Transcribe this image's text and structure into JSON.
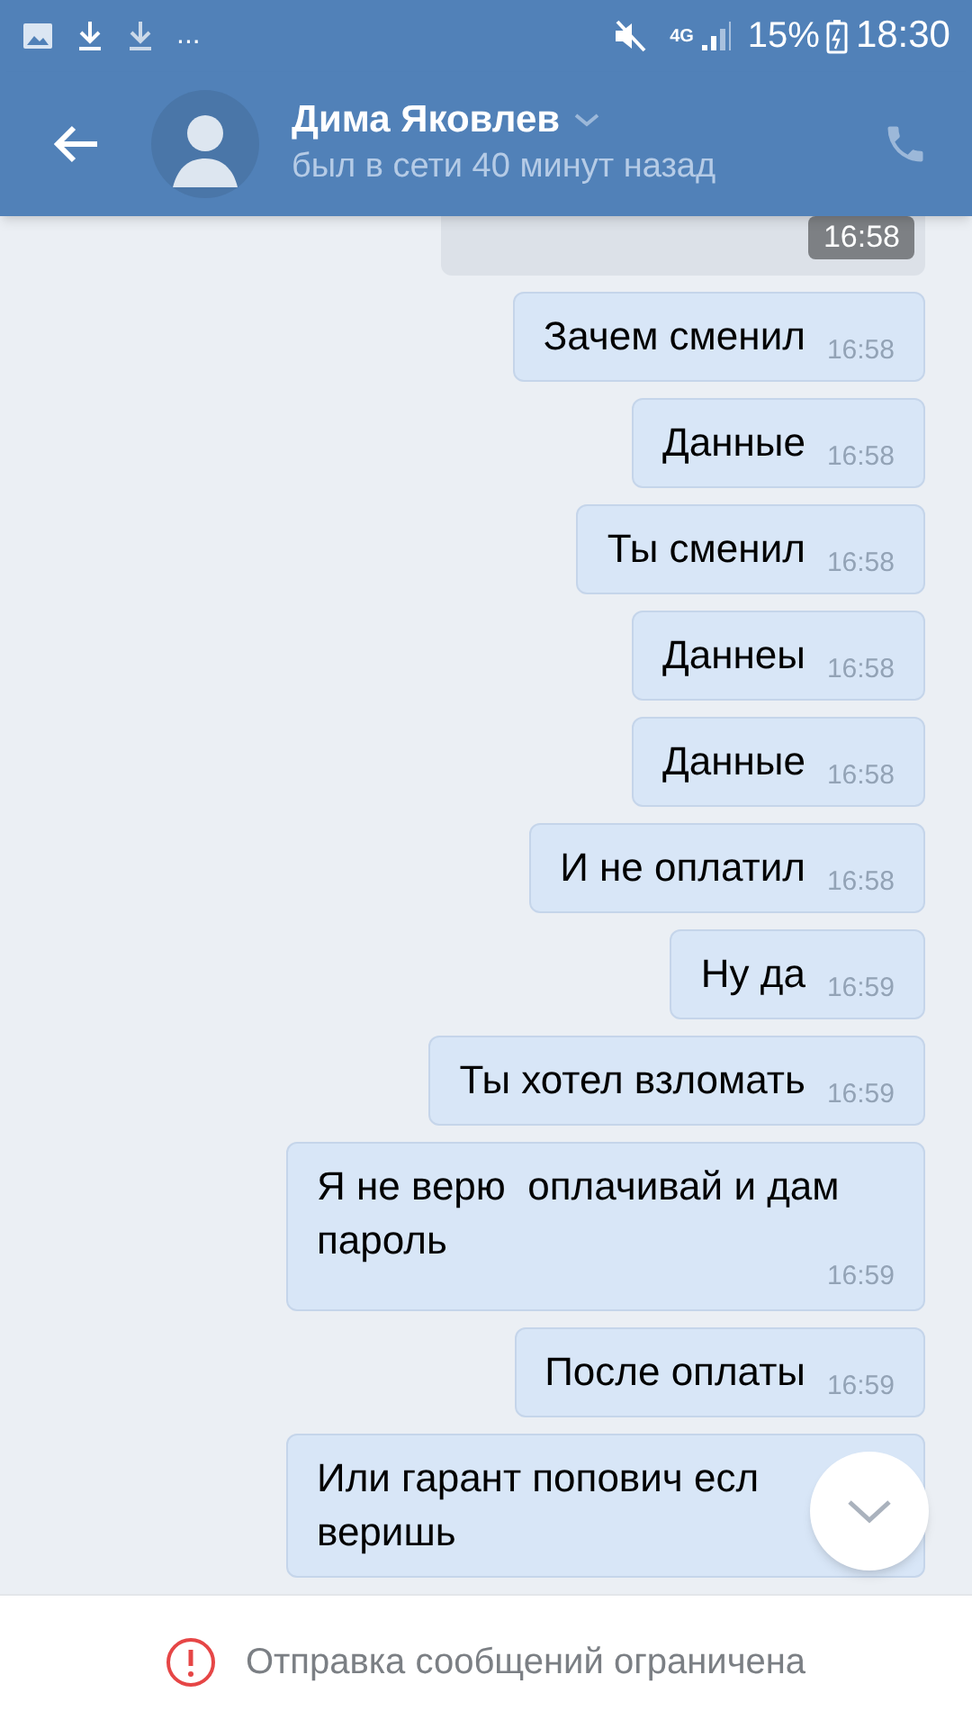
{
  "status_bar": {
    "more": "...",
    "network": "4G",
    "battery": "15%",
    "time": "18:30"
  },
  "header": {
    "name": "Дима Яковлев",
    "status": "был в сети 40 минут назад"
  },
  "top_message": {
    "time": "16:58"
  },
  "messages": [
    {
      "text": "Зачем сменил",
      "time": "16:58"
    },
    {
      "text": "Данные",
      "time": "16:58"
    },
    {
      "text": "Ты сменил",
      "time": "16:58"
    },
    {
      "text": "Даннеы",
      "time": "16:58"
    },
    {
      "text": "Данные",
      "time": "16:58"
    },
    {
      "text": "И не оплатил",
      "time": "16:58"
    },
    {
      "text": "Ну да",
      "time": "16:59"
    },
    {
      "text": "Ты хотел взломать",
      "time": "16:59"
    },
    {
      "text": "Я не верю  оплачивай и дам\nпароль",
      "time": "16:59"
    },
    {
      "text": "После оплаты",
      "time": "16:59"
    },
    {
      "text": "Или гарант попович есл\nверишь"
    }
  ],
  "notice": {
    "text": "Отправка сообщений ограничена"
  }
}
